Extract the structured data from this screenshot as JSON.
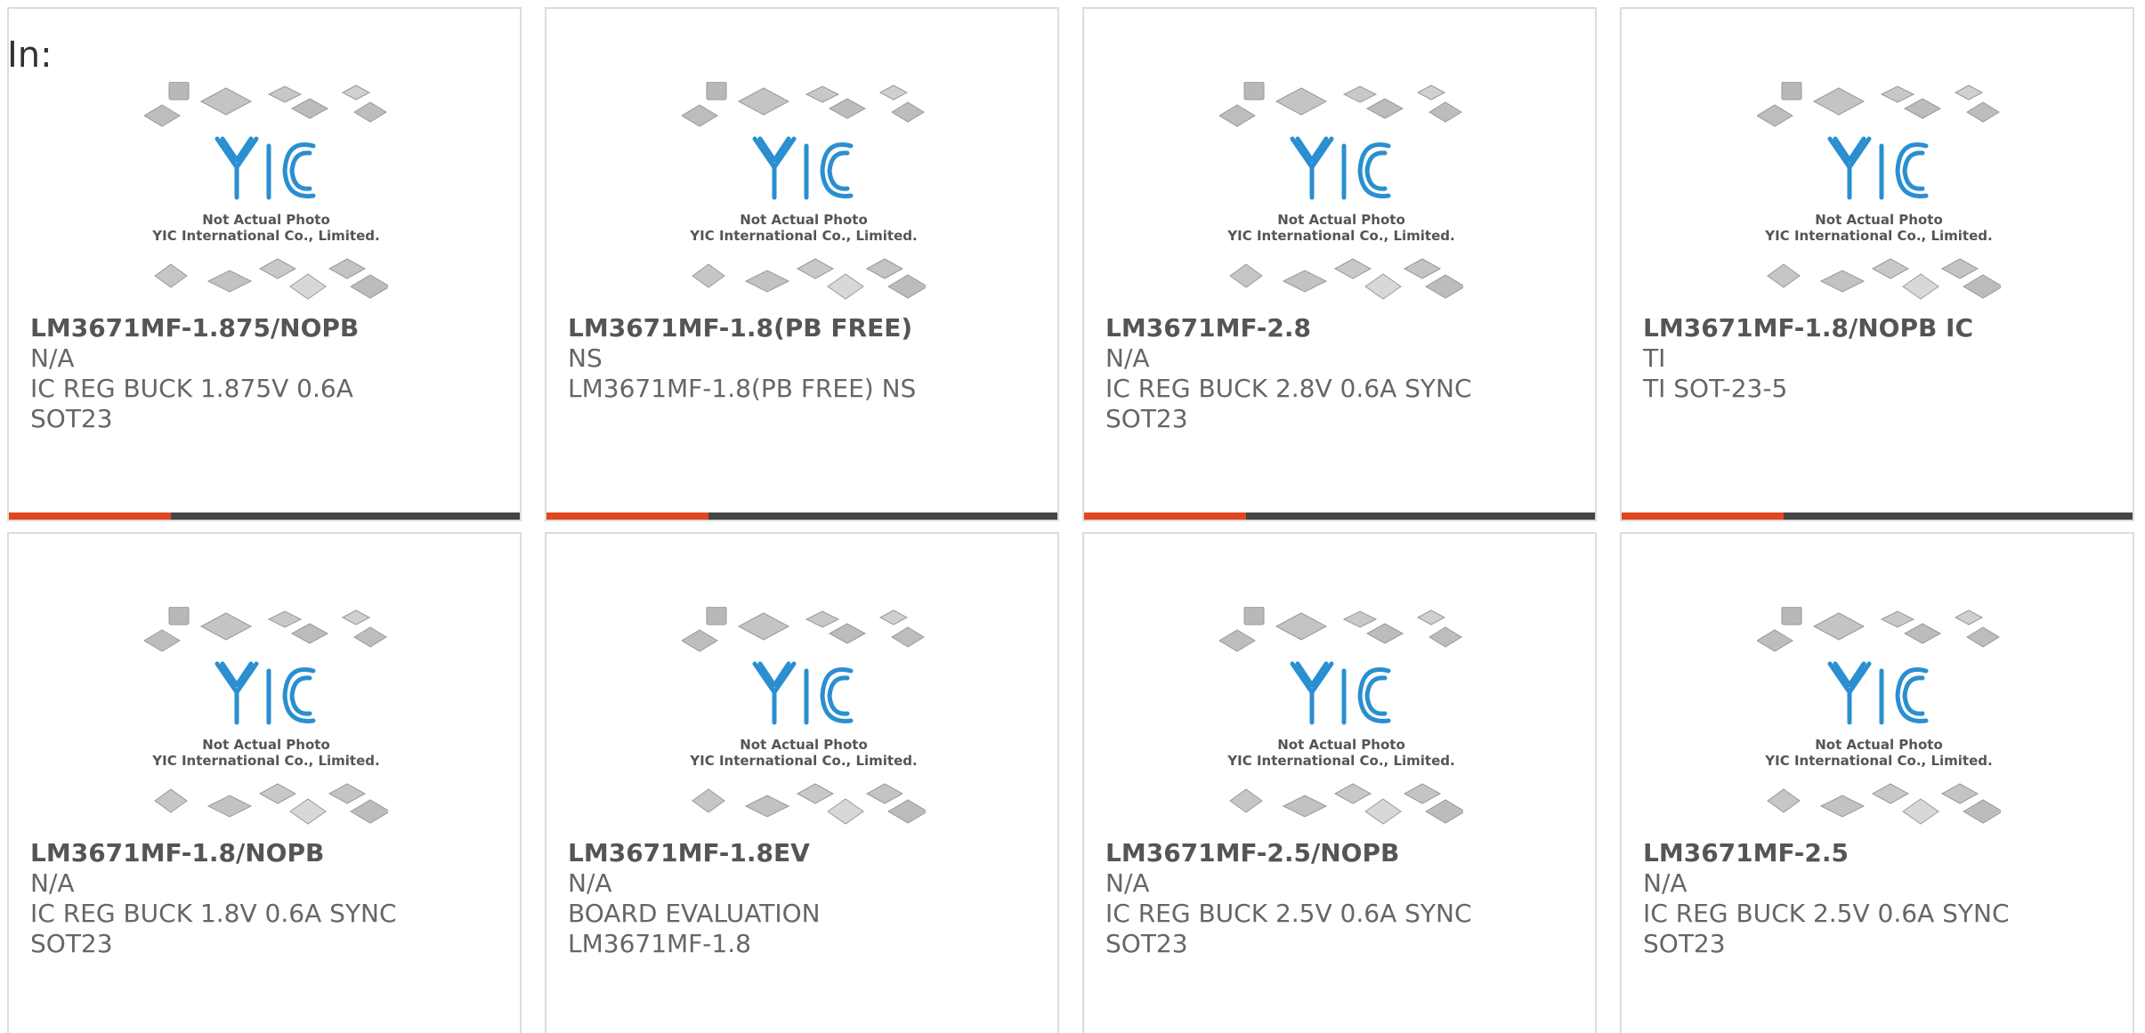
{
  "heading": "In:",
  "photo": {
    "line1": "Not Actual Photo",
    "line2": "YIC International Co., Limited.",
    "logo": "YIC"
  },
  "colors": {
    "accent": "#e0471f",
    "bar": "#454545",
    "logo": "#2a8fd0",
    "border": "#dcdcdc"
  },
  "products": [
    {
      "part": "LM3671MF-1.875/NOPB",
      "maker": "N/A",
      "desc": "IC REG BUCK 1.875V 0.6A SOT23"
    },
    {
      "part": "LM3671MF-1.8(PB FREE)",
      "maker": "NS",
      "desc": "LM3671MF-1.8(PB FREE) NS"
    },
    {
      "part": "LM3671MF-2.8",
      "maker": "N/A",
      "desc": "IC REG BUCK 2.8V 0.6A SYNC SOT23"
    },
    {
      "part": "LM3671MF-1.8/NOPB IC",
      "maker": "TI",
      "desc": "TI SOT-23-5"
    },
    {
      "part": "LM3671MF-1.8/NOPB",
      "maker": "N/A",
      "desc": "IC REG BUCK 1.8V 0.6A SYNC SOT23"
    },
    {
      "part": "LM3671MF-1.8EV",
      "maker": "N/A",
      "desc": "BOARD EVALUATION LM3671MF-1.8"
    },
    {
      "part": "LM3671MF-2.5/NOPB",
      "maker": "N/A",
      "desc": "IC REG BUCK 2.5V 0.6A SYNC SOT23"
    },
    {
      "part": "LM3671MF-2.5",
      "maker": "N/A",
      "desc": "IC REG BUCK 2.5V 0.6A SYNC SOT23"
    }
  ]
}
